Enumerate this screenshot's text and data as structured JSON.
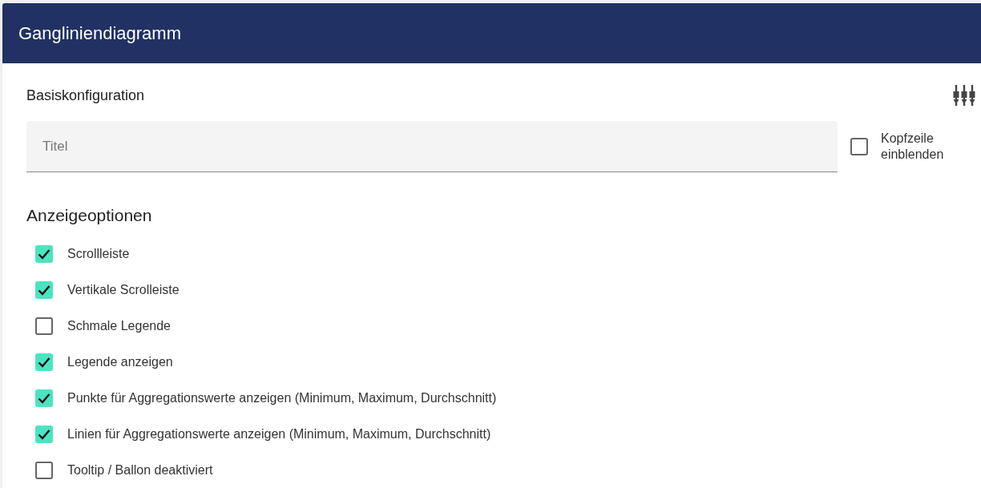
{
  "header": {
    "title": "Gangliniendiagramm"
  },
  "basic": {
    "title": "Basiskonfiguration",
    "field": {
      "placeholder": "Titel"
    },
    "header_toggle": {
      "label": "Kopfzeile einblenden",
      "checked": false
    }
  },
  "display": {
    "title": "Anzeigeoptionen",
    "options": [
      {
        "label": "Scrollleiste",
        "checked": true
      },
      {
        "label": "Vertikale Scrolleiste",
        "checked": true
      },
      {
        "label": "Schmale Legende",
        "checked": false
      },
      {
        "label": "Legende anzeigen",
        "checked": true
      },
      {
        "label": "Punkte für Aggregationswerte anzeigen (Minimum, Maximum, Durchschnitt)",
        "checked": true
      },
      {
        "label": "Linien für Aggregationswerte anzeigen (Minimum, Maximum, Durchschnitt)",
        "checked": true
      },
      {
        "label": "Tooltip / Ballon deaktiviert",
        "checked": false
      }
    ]
  }
}
